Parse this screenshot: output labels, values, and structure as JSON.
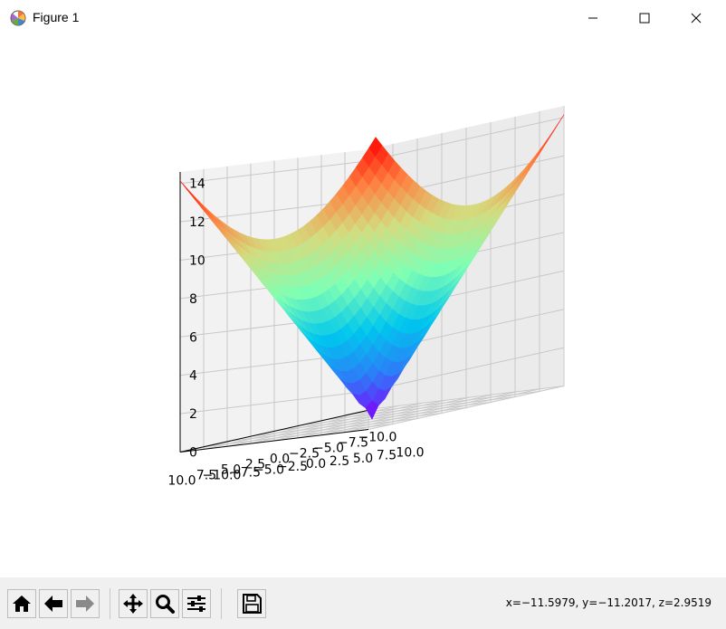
{
  "window": {
    "title": "Figure 1",
    "icon": "matplotlib-logo-icon",
    "controls": [
      "minimize-icon",
      "maximize-icon",
      "close-icon"
    ]
  },
  "toolbar": {
    "buttons": [
      {
        "name": "home-button",
        "icon": "home-icon"
      },
      {
        "name": "back-button",
        "icon": "arrow-left-icon"
      },
      {
        "name": "forward-button",
        "icon": "arrow-right-icon"
      },
      {
        "name": "pan-button",
        "icon": "move-arrows-icon"
      },
      {
        "name": "zoom-button",
        "icon": "magnifier-icon"
      },
      {
        "name": "subplots-button",
        "icon": "sliders-icon"
      },
      {
        "name": "save-button",
        "icon": "floppy-disk-icon"
      }
    ],
    "coordinates": "x=−11.5979, y=−11.2017, z=2.9519"
  },
  "chart_data": {
    "type": "surface-3d",
    "function": "z = sqrt(x^2 + y^2)",
    "colormap": "rainbow",
    "x_ticks": [
      "−10.0",
      "−7.5",
      "−5.0",
      "−2.5",
      "0.0",
      "2.5",
      "5.0",
      "7.5",
      "10.0"
    ],
    "y_ticks": [
      "−10.0",
      "−7.5",
      "−5.0",
      "−2.5",
      "0.0",
      "2.5",
      "5.0",
      "7.5",
      "10.0"
    ],
    "z_ticks": [
      "0",
      "2",
      "4",
      "6",
      "8",
      "10",
      "12",
      "14"
    ],
    "xlim": [
      -10,
      10
    ],
    "ylim": [
      -10,
      10
    ],
    "zlim": [
      0,
      14.14
    ],
    "grid": true
  }
}
